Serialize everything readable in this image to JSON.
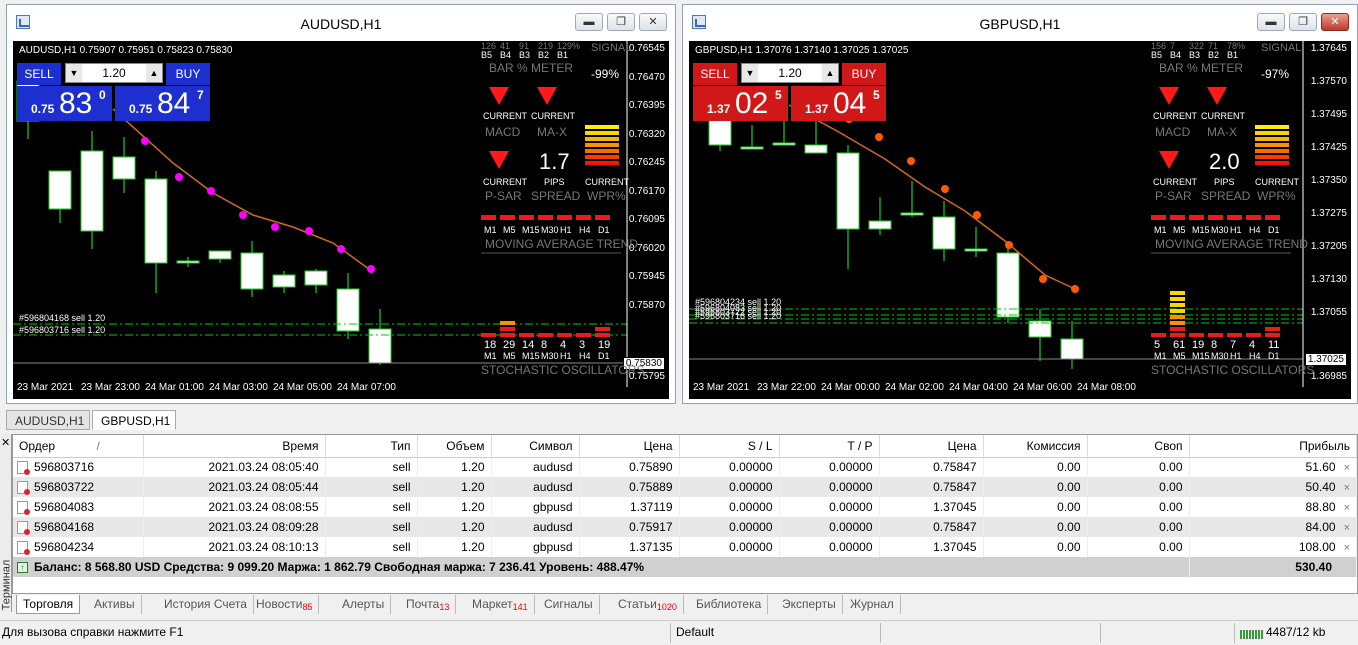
{
  "windows": [
    {
      "title": "AUDUSD,H1",
      "symbol_line": "AUDUSD,H1  0.75907 0.75951 0.75823 0.75830",
      "trade": {
        "sell_label": "SELL",
        "buy_label": "BUY",
        "lot": "1.20",
        "sell_prefix": "0.75",
        "sell_big": "83",
        "sell_sup": "0",
        "buy_prefix": "0.75",
        "buy_big": "84",
        "buy_sup": "7",
        "color": "#1e2fd0"
      },
      "price_ticks": [
        "0.76545",
        "0.76470",
        "0.76395",
        "0.76320",
        "0.76245",
        "0.76170",
        "0.76095",
        "0.76020",
        "0.75945",
        "0.75870",
        "0.75830",
        "0.75795"
      ],
      "time_labels": [
        "23 Mar 2021",
        "23 Mar 23:00",
        "24 Mar 01:00",
        "24 Mar 03:00",
        "24 Mar 05:00",
        "24 Mar 07:00"
      ],
      "trade_labels": [
        "#596804168 sell 1.20",
        "#596803716 sell 1.20"
      ],
      "panel": {
        "top_counts": [
          "126",
          "41",
          "91",
          "219",
          "129%"
        ],
        "signal": "SIGNAL",
        "tf_top": [
          "B5",
          "B4",
          "B3",
          "B2",
          "B1"
        ],
        "bar_meter": "BAR % METER",
        "pct": "-99%",
        "current": "CURRENT",
        "macd": "MACD",
        "max": "MA-X",
        "psar": "P-SAR",
        "pips": "PIPS",
        "spread_val": "1.7",
        "spread": "SPREAD",
        "wpr": "WPR%",
        "tfs": [
          "M1",
          "M5",
          "M15",
          "M30",
          "H1",
          "H4",
          "D1"
        ],
        "ma_trend": "MOVING AVERAGE TREND",
        "stoch_vals": [
          "18",
          "29",
          "14",
          "8",
          "4",
          "3",
          "19"
        ],
        "stoch": "STOCHASTIC OSCILLATORS"
      }
    },
    {
      "title": "GBPUSD,H1",
      "symbol_line": "GBPUSD,H1  1.37076 1.37140 1.37025 1.37025",
      "trade": {
        "sell_label": "SELL",
        "buy_label": "BUY",
        "lot": "1.20",
        "sell_prefix": "1.37",
        "sell_big": "02",
        "sell_sup": "5",
        "buy_prefix": "1.37",
        "buy_big": "04",
        "buy_sup": "5",
        "color": "#d01818"
      },
      "price_ticks": [
        "1.37645",
        "1.37570",
        "1.37495",
        "1.37425",
        "1.37350",
        "1.37275",
        "1.37205",
        "1.37130",
        "1.37055",
        "1.37025",
        "1.36985"
      ],
      "time_labels": [
        "23 Mar 2021",
        "23 Mar 22:00",
        "24 Mar 00:00",
        "24 Mar 02:00",
        "24 Mar 04:00",
        "24 Mar 06:00",
        "24 Mar 08:00"
      ],
      "trade_labels": [
        "#596804234 sell 1.20",
        "#596804083 sell 1.20",
        "#596803722 sell 1.20",
        "#596803716 sell 1.20"
      ],
      "panel": {
        "top_counts": [
          "156",
          "7",
          "322",
          "71",
          "78%"
        ],
        "signal": "SIGNAL",
        "tf_top": [
          "B5",
          "B4",
          "B3",
          "B2",
          "B1"
        ],
        "bar_meter": "BAR % METER",
        "pct": "-97%",
        "current": "CURRENT",
        "macd": "MACD",
        "max": "MA-X",
        "psar": "P-SAR",
        "pips": "PIPS",
        "spread_val": "2.0",
        "spread": "SPREAD",
        "wpr": "WPR%",
        "tfs": [
          "M1",
          "M5",
          "M15",
          "M30",
          "H1",
          "H4",
          "D1"
        ],
        "ma_trend": "MOVING AVERAGE TREND",
        "stoch_vals": [
          "5",
          "61",
          "19",
          "8",
          "7",
          "4",
          "11"
        ],
        "stoch": "STOCHASTIC OSCILLATORS"
      }
    }
  ],
  "chart_tabs": [
    "AUDUSD,H1",
    "GBPUSD,H1"
  ],
  "table": {
    "headers": [
      "Ордер",
      "/",
      "Время",
      "Тип",
      "Объем",
      "Символ",
      "Цена",
      "S / L",
      "T / P",
      "Цена",
      "Комиссия",
      "Своп",
      "Прибыль"
    ],
    "rows": [
      [
        "596803716",
        "2021.03.24 08:05:40",
        "sell",
        "1.20",
        "audusd",
        "0.75890",
        "0.00000",
        "0.00000",
        "0.75847",
        "0.00",
        "0.00",
        "51.60"
      ],
      [
        "596803722",
        "2021.03.24 08:05:44",
        "sell",
        "1.20",
        "audusd",
        "0.75889",
        "0.00000",
        "0.00000",
        "0.75847",
        "0.00",
        "0.00",
        "50.40"
      ],
      [
        "596804083",
        "2021.03.24 08:08:55",
        "sell",
        "1.20",
        "gbpusd",
        "1.37119",
        "0.00000",
        "0.00000",
        "1.37045",
        "0.00",
        "0.00",
        "88.80"
      ],
      [
        "596804168",
        "2021.03.24 08:09:28",
        "sell",
        "1.20",
        "audusd",
        "0.75917",
        "0.00000",
        "0.00000",
        "0.75847",
        "0.00",
        "0.00",
        "84.00"
      ],
      [
        "596804234",
        "2021.03.24 08:10:13",
        "sell",
        "1.20",
        "gbpusd",
        "1.37135",
        "0.00000",
        "0.00000",
        "1.37045",
        "0.00",
        "0.00",
        "108.00"
      ]
    ],
    "balance_line": "Баланс: 8 568.80 USD  Средства: 9 099.20  Маржа: 1 862.79  Свободная маржа: 7 236.41  Уровень: 488.47%",
    "total_profit": "530.40",
    "delete_glyph": "×"
  },
  "terminal_label": "Терминал",
  "bottom_tabs": [
    {
      "label": "Торговля",
      "badge": ""
    },
    {
      "label": "Активы",
      "badge": ""
    },
    {
      "label": "История Счета",
      "badge": ""
    },
    {
      "label": "Новости",
      "badge": "85"
    },
    {
      "label": "Алерты",
      "badge": ""
    },
    {
      "label": "Почта",
      "badge": "13"
    },
    {
      "label": "Маркет",
      "badge": "141"
    },
    {
      "label": "Сигналы",
      "badge": ""
    },
    {
      "label": "Статьи",
      "badge": "1020"
    },
    {
      "label": "Библиотека",
      "badge": ""
    },
    {
      "label": "Эксперты",
      "badge": ""
    },
    {
      "label": "Журнал",
      "badge": ""
    }
  ],
  "status": {
    "help": "Для вызова справки нажмите F1",
    "profile": "Default",
    "traffic": "4487/12 kb"
  },
  "colors": {
    "candle_up": "#ffffff",
    "candle_wick": "#22cc22",
    "ma_line": "#d2691e",
    "sar_aud": "#ff00ff",
    "sar_gbp": "#ff5a00"
  }
}
